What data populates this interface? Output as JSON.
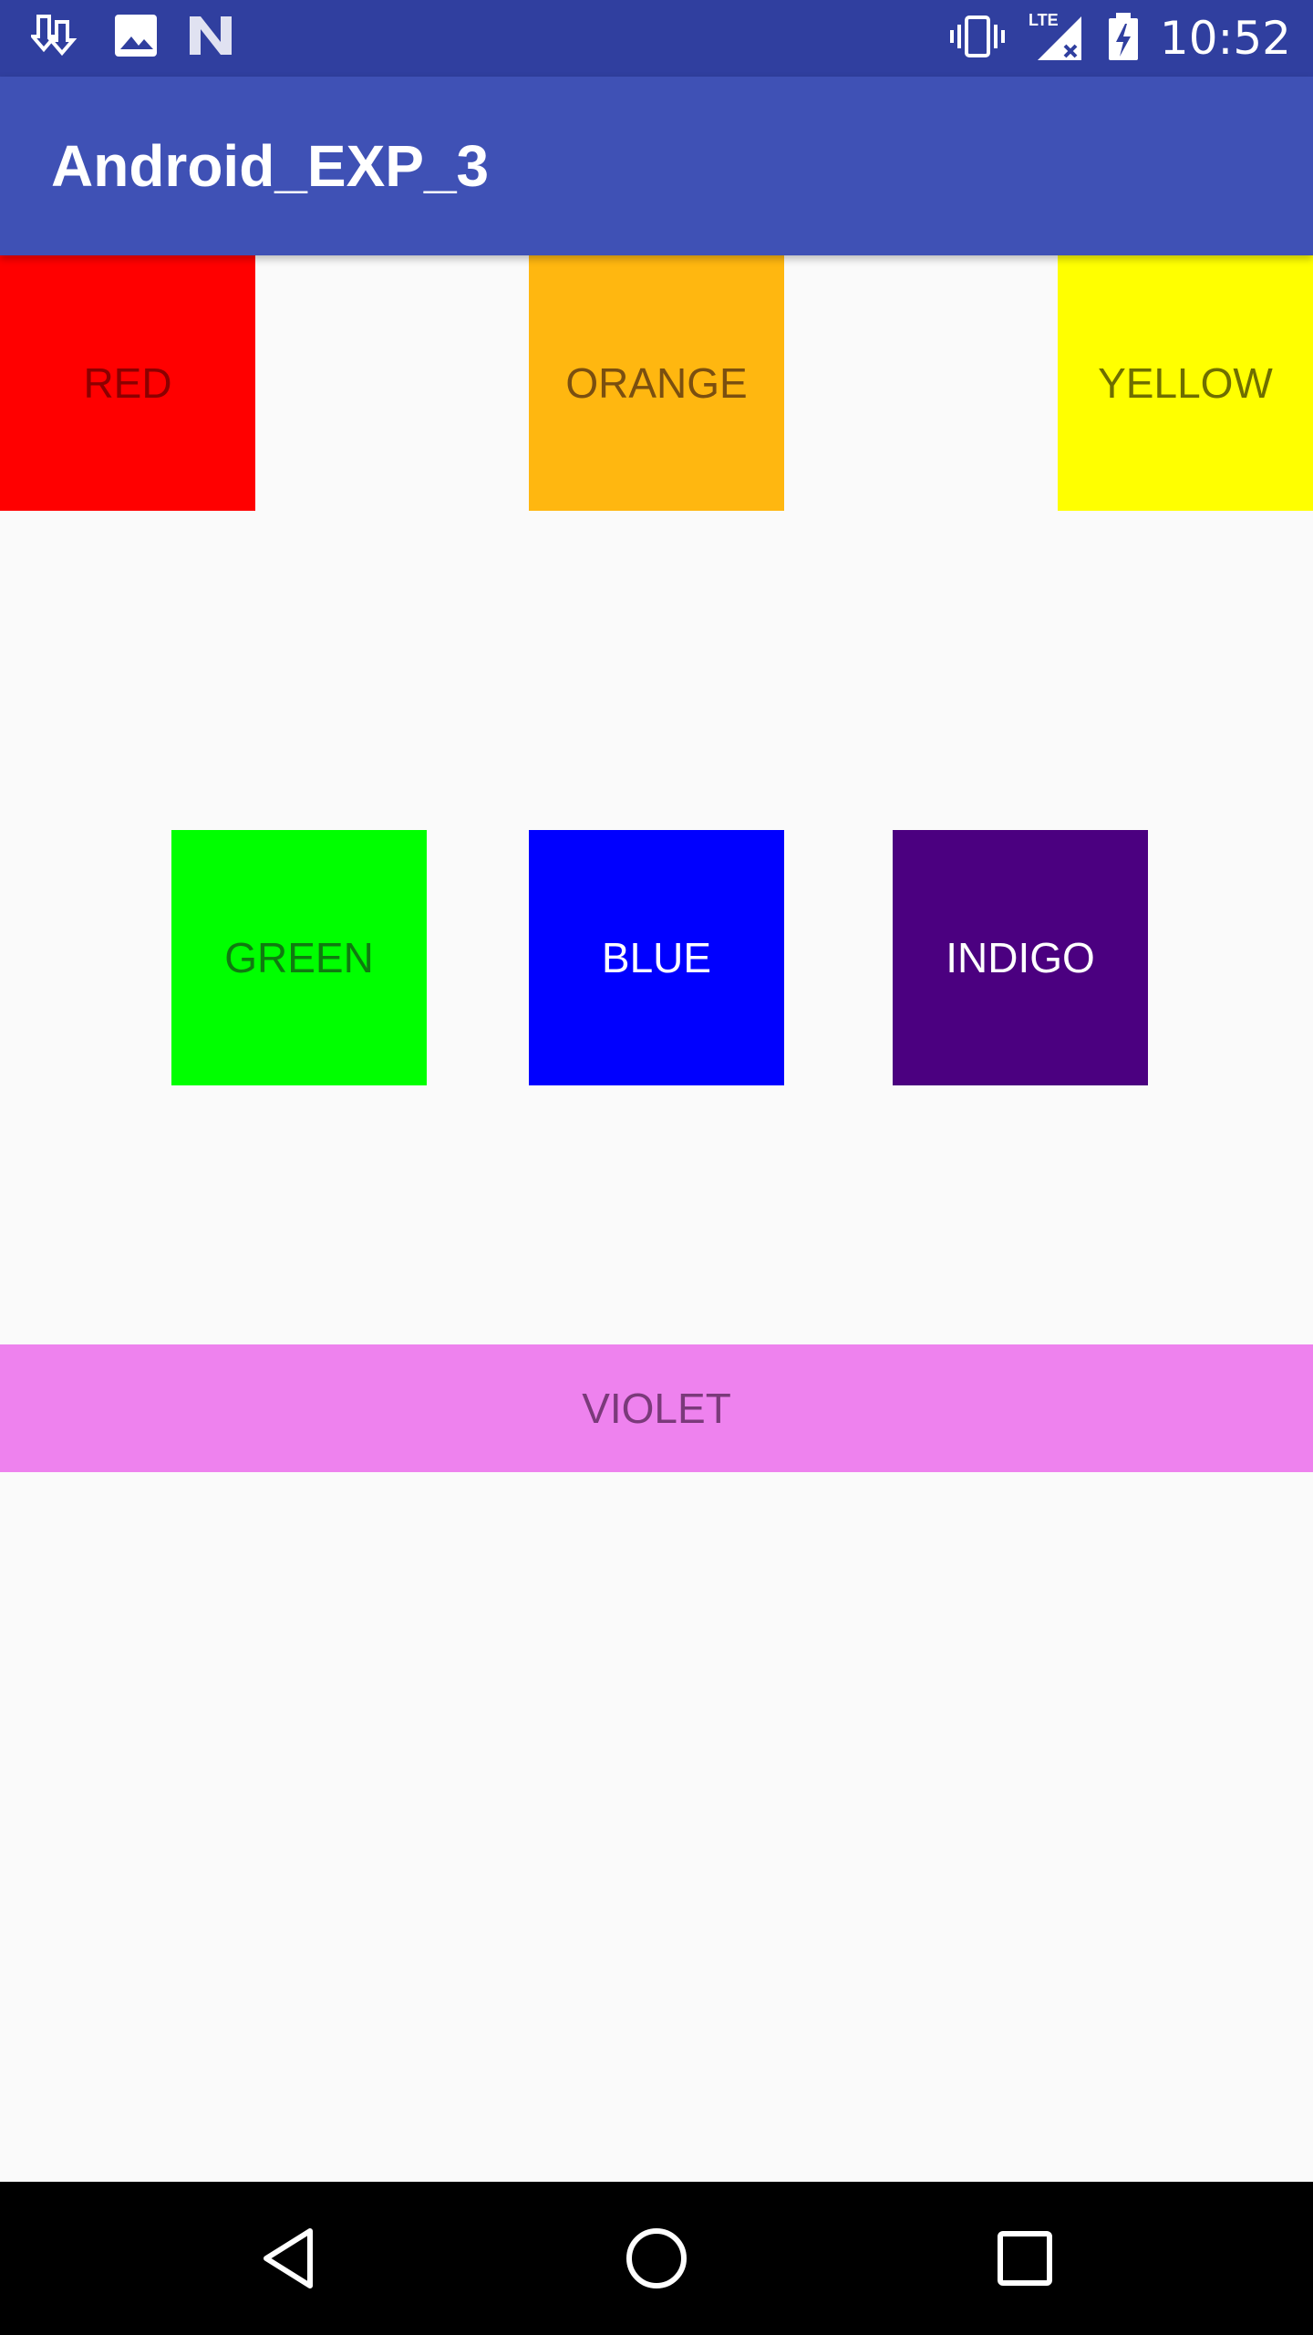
{
  "status_bar": {
    "time": "10:52",
    "network": "LTE",
    "left_icons": [
      "download-icon",
      "image-icon",
      "android-n-icon"
    ],
    "right_icons": [
      "vibrate-icon",
      "lte-signal-icon",
      "battery-charging-icon"
    ]
  },
  "app_bar": {
    "title": "Android_EXP_3"
  },
  "buttons": {
    "red": {
      "label": "RED",
      "bg": "#ff0000",
      "fg": "#8b0000"
    },
    "orange": {
      "label": "ORANGE",
      "bg": "#ffb710",
      "fg": "#7a4f10"
    },
    "yellow": {
      "label": "YELLOW",
      "bg": "#ffff00",
      "fg": "#6e6e00"
    },
    "green": {
      "label": "GREEN",
      "bg": "#00ff00",
      "fg": "#107a10"
    },
    "blue": {
      "label": "BLUE",
      "bg": "#0000ff",
      "fg": "#ffffff"
    },
    "indigo": {
      "label": "INDIGO",
      "bg": "#4b0080",
      "fg": "#ffffff"
    },
    "violet": {
      "label": "VIOLET",
      "bg": "#ee82ee",
      "fg": "#7a3a7a"
    }
  },
  "nav_bar": {
    "icons": [
      "back-icon",
      "home-icon",
      "recents-icon"
    ]
  },
  "colors": {
    "status_bar": "#303f9f",
    "app_bar": "#3f51b5",
    "background": "#fafafa"
  }
}
